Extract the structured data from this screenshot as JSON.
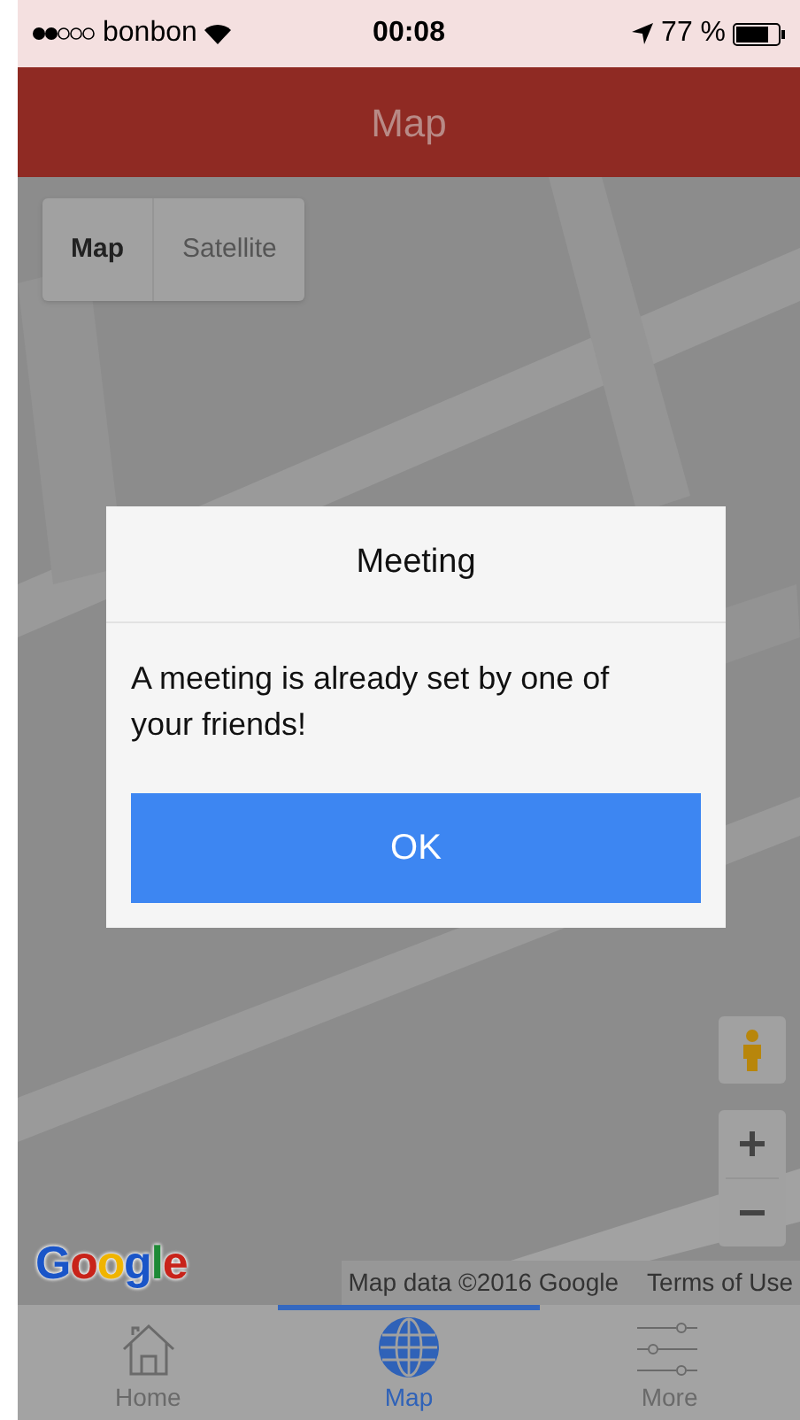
{
  "status_bar": {
    "carrier": "bonbon",
    "time": "00:08",
    "battery": "77 %"
  },
  "header": {
    "title": "Map"
  },
  "map": {
    "kind": "picture",
    "type_control": [
      {
        "label": "Map",
        "selected": true
      },
      {
        "label": "Satellite",
        "selected": false
      }
    ],
    "logo": "Google",
    "attribution": "Map data ©2016 Google",
    "terms": "Terms of Use"
  },
  "dialog": {
    "title": "Meeting",
    "message": "A meeting is already set by one of your friends!",
    "button": "OK"
  },
  "tab_bar": [
    {
      "label": "Home",
      "kind": "home",
      "selected": false
    },
    {
      "label": "Map",
      "kind": "globe",
      "selected": true
    },
    {
      "label": "More",
      "kind": "sliders",
      "selected": false
    }
  ]
}
